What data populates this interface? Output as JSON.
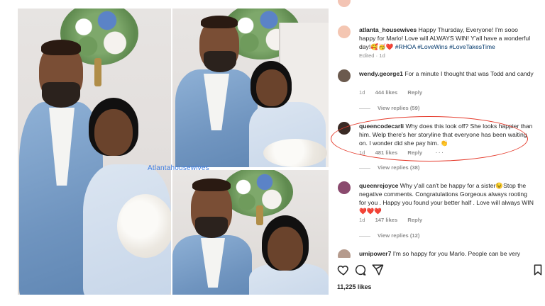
{
  "watermark": "Atlantahousewives",
  "comments": [
    {
      "username": "atlanta_housewives",
      "text": "Happy Thursday, Everyone! I'm sooo happy for Marlo! Love will ALWAYS WIN! Y'all have a wonderful day!🥰🥳❤️ ",
      "hashtags": "#RHOA #LoveWins #LoveTakesTime",
      "meta": "Edited · 1d",
      "avatar_color": "#f4c6b2"
    },
    {
      "username": "wendy.george1",
      "text": "For a minute I thought that was Todd and candy",
      "time": "1d",
      "likes": "444 likes",
      "reply": "Reply",
      "view_replies": "View replies (59)",
      "avatar_color": "#6b5a4e"
    },
    {
      "username": "queencodecarli",
      "text": "Why does this look off? She looks happier than him. Welp there's her storyline that everyone has been waiting on. I wonder did she pay him. 👏",
      "time": "1d",
      "likes": "481 likes",
      "reply": "Reply",
      "more": "···",
      "view_replies": "View replies (38)",
      "avatar_color": "#3a2a25"
    },
    {
      "username": "queenrejoyce",
      "text": "Why y'all can't be happy for a sister😉Stop the negative comments. Congratulations Gorgeous always rooting for you . Happy you found your better half . Love will always WIN❤️❤️❤️",
      "time": "1d",
      "likes": "147 likes",
      "reply": "Reply",
      "view_replies": "View replies (12)",
      "avatar_color": "#8a4a6e"
    },
    {
      "username": "umipower7",
      "text": "I'm so happy for you Marlo. People can be very",
      "avatar_color": "#b59a8c"
    }
  ],
  "actions": {
    "like_icon": "heart-icon",
    "comment_icon": "comment-bubble-icon",
    "share_icon": "send-icon",
    "save_icon": "bookmark-icon"
  },
  "likes_count": "11,225 likes",
  "colors": {
    "highlight": "#e53b2c",
    "hashtag": "#00376b",
    "meta": "#8e8e8e"
  }
}
